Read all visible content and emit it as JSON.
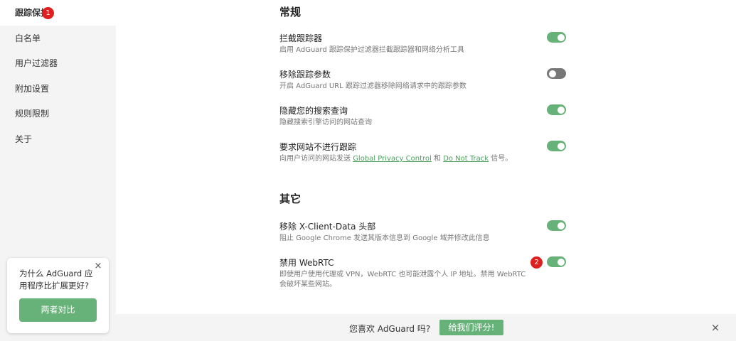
{
  "sidebar": {
    "items": [
      {
        "label": "跟踪保护",
        "active": true,
        "badge": "1"
      },
      {
        "label": "白名单"
      },
      {
        "label": "用户过滤器"
      },
      {
        "label": "附加设置"
      },
      {
        "label": "规则限制"
      },
      {
        "label": "关于"
      }
    ]
  },
  "promo": {
    "text": "为什么 AdGuard 应用程序比扩展更好?",
    "close_icon": "×",
    "button_label": "两者对比"
  },
  "sections": {
    "general_title": "常规",
    "other_title": "其它"
  },
  "settings": [
    {
      "title": "拦截跟踪器",
      "desc": "启用 AdGuard 跟踪保护过滤器拦截跟踪器和网络分析工具",
      "enabled": true
    },
    {
      "title": "移除跟踪参数",
      "desc": "开启 AdGuard URL 跟踪过滤器移除网络请求中的跟踪参数",
      "enabled": false
    },
    {
      "title": "隐藏您的搜索查询",
      "desc": "隐藏搜索引擎访问的网站查询",
      "enabled": true
    },
    {
      "title": "要求网站不进行跟踪",
      "desc_prefix": "向用户访问的网站发送",
      "link1": "Global Privacy Control",
      "desc_mid": "和",
      "link2": "Do Not Track",
      "desc_suffix": "信号。",
      "enabled": true
    },
    {
      "title": "移除 X-Client-Data 头部",
      "desc": "阻止 Google Chrome 发送其版本信息到 Google 域并修改此信息",
      "enabled": true
    },
    {
      "title": "禁用 WebRTC",
      "desc": "即使用户使用代理或 VPN，WebRTC 也可能泄露个人 IP 地址。禁用 WebRTC 会破坏某些网站。",
      "enabled": true,
      "badge": "2"
    }
  ],
  "footer": {
    "text": "您喜欢 AdGuard 吗?",
    "rate_label": "给我们评分!",
    "close_icon": "×"
  },
  "colors": {
    "accent": "#67b279",
    "toggle_off": "#777777",
    "badge": "#e02020",
    "sidebar_bg": "#f4f4f4"
  }
}
